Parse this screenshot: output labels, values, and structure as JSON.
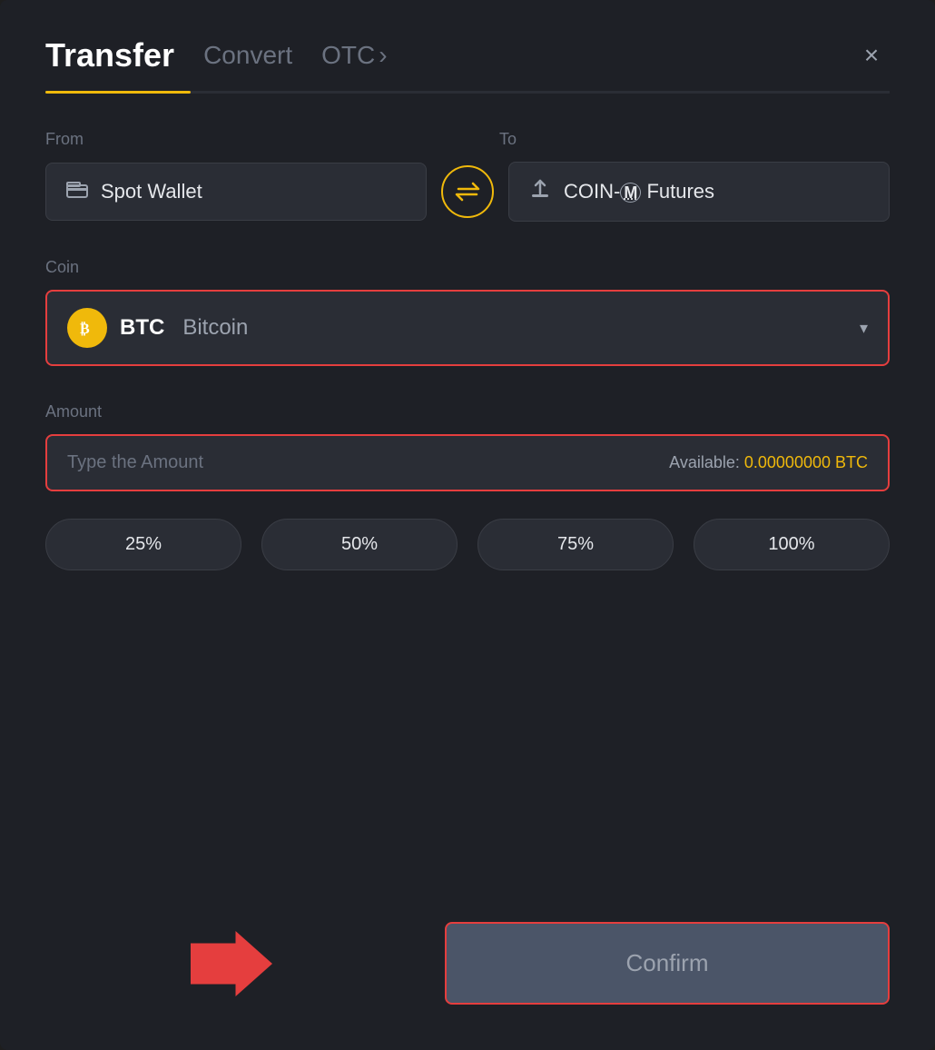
{
  "header": {
    "title": "Transfer",
    "tab_convert": "Convert",
    "tab_otc": "OTC",
    "tab_otc_chevron": "›",
    "close_label": "×"
  },
  "from_section": {
    "label": "From",
    "wallet_icon": "▬",
    "wallet_text": "Spot Wallet"
  },
  "to_section": {
    "label": "To",
    "futures_icon": "↑",
    "futures_text": "COIN-M Futures"
  },
  "swap": {
    "icon": "⇄"
  },
  "coin_section": {
    "label": "Coin",
    "coin_symbol": "BTC",
    "coin_name": "Bitcoin",
    "btc_icon": "₿"
  },
  "amount_section": {
    "label": "Amount",
    "placeholder": "Type the Amount",
    "available_label": "Available:",
    "available_value": "0.00000000 BTC"
  },
  "pct_buttons": {
    "pct_25": "25%",
    "pct_50": "50%",
    "pct_75": "75%",
    "pct_100": "100%"
  },
  "confirm_button": {
    "label": "Confirm"
  }
}
